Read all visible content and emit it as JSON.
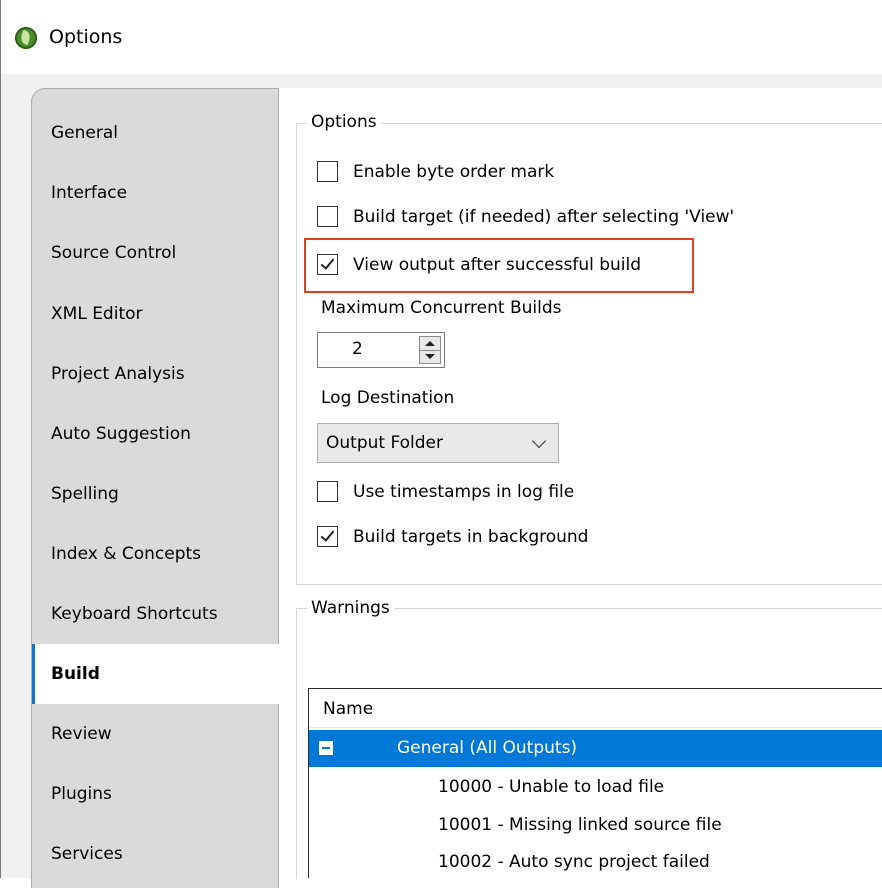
{
  "window": {
    "title": "Options"
  },
  "sidebar": {
    "items": [
      {
        "label": "General"
      },
      {
        "label": "Interface"
      },
      {
        "label": "Source Control"
      },
      {
        "label": "XML Editor"
      },
      {
        "label": "Project Analysis"
      },
      {
        "label": "Auto Suggestion"
      },
      {
        "label": "Spelling"
      },
      {
        "label": "Index & Concepts"
      },
      {
        "label": "Keyboard Shortcuts"
      },
      {
        "label": "Build"
      },
      {
        "label": "Review"
      },
      {
        "label": "Plugins"
      },
      {
        "label": "Services"
      }
    ],
    "selected": "Build"
  },
  "options": {
    "group_title": "Options",
    "enable_bom": {
      "label": "Enable byte order mark",
      "checked": false
    },
    "build_target": {
      "label": "Build target (if needed) after selecting 'View'",
      "checked": false
    },
    "view_output": {
      "label": "View output after successful build",
      "checked": true
    },
    "max_builds": {
      "label": "Maximum Concurrent Builds",
      "value": "2"
    },
    "log_destination": {
      "label": "Log Destination",
      "value": "Output Folder"
    },
    "timestamps": {
      "label": "Use timestamps in log file",
      "checked": false
    },
    "background": {
      "label": "Build targets in background",
      "checked": true
    }
  },
  "warnings": {
    "group_title": "Warnings",
    "column_name": "Name",
    "rows": [
      {
        "label": "General (All Outputs)"
      },
      {
        "label": "10000 - Unable to load file"
      },
      {
        "label": "10001 - Missing linked source file"
      },
      {
        "label": "10002 - Auto sync project failed"
      }
    ]
  },
  "colors": {
    "highlight": "#e2401b",
    "selection": "#0078d7",
    "active_tab_accent": "#0a74da"
  }
}
